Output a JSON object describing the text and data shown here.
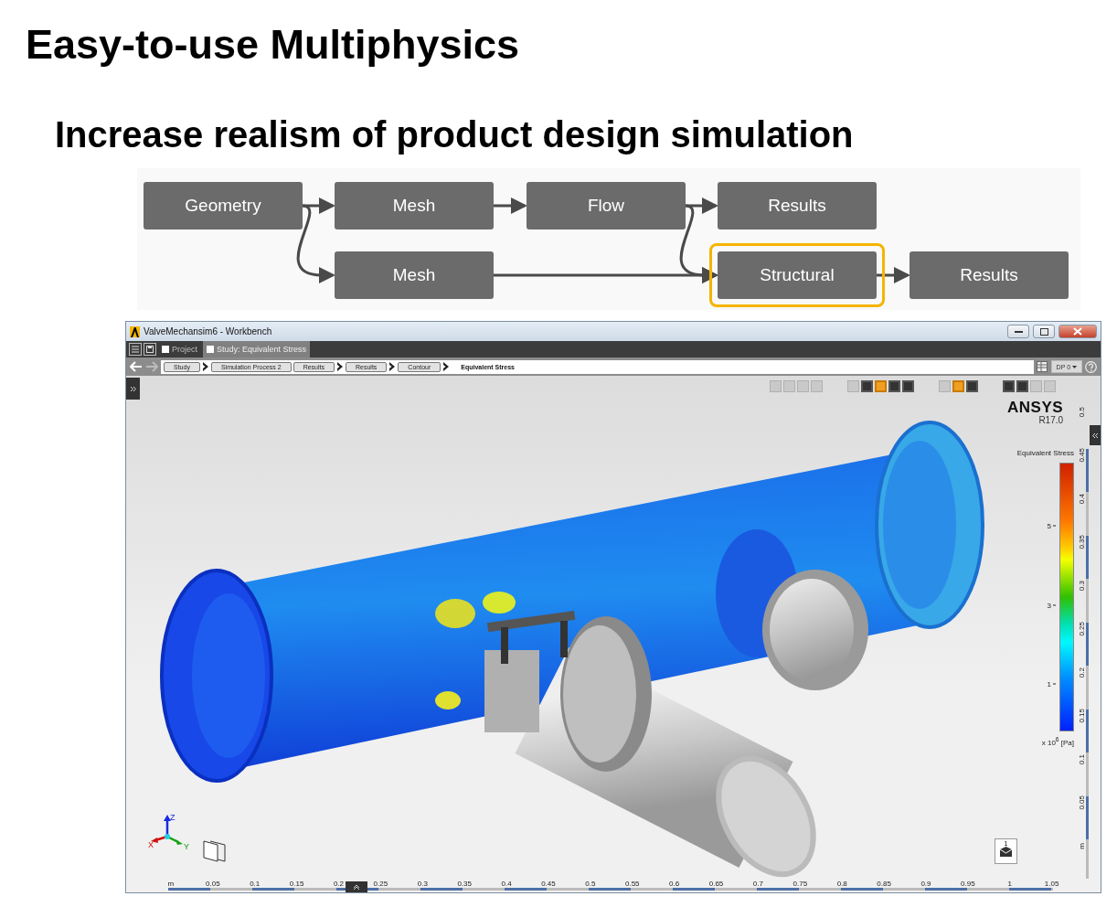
{
  "slide": {
    "title": "Easy-to-use Multiphysics",
    "subtitle": "Increase realism of product design simulation"
  },
  "workflow": {
    "nodes": [
      {
        "label": "Geometry",
        "highlighted": false
      },
      {
        "label": "Mesh",
        "highlighted": false
      },
      {
        "label": "Flow",
        "highlighted": false
      },
      {
        "label": "Results",
        "highlighted": false
      },
      {
        "label": "Mesh",
        "highlighted": false
      },
      {
        "label": "Structural",
        "highlighted": true
      },
      {
        "label": "Results",
        "highlighted": false
      }
    ]
  },
  "window": {
    "title": "ValveMechansim6 - Workbench",
    "tabs": [
      {
        "label": "Project",
        "selected": false
      },
      {
        "label": "Study: Equivalent Stress",
        "selected": true
      }
    ],
    "breadcrumb": [
      {
        "label": "Study",
        "kind": "button",
        "arrow_before": false
      },
      {
        "label": "Simulation Process 2",
        "kind": "button",
        "arrow_before": true
      },
      {
        "label": "Results",
        "kind": "button",
        "arrow_before": false
      },
      {
        "label": "Results",
        "kind": "button",
        "arrow_before": true
      },
      {
        "label": "Contour",
        "kind": "button",
        "arrow_before": true
      },
      {
        "label": "Equivalent Stress",
        "kind": "current",
        "arrow_before": true
      }
    ],
    "design_point": "DP 0",
    "toolbar_groups": [
      [
        {
          "active": false,
          "disabled": true
        },
        {
          "active": false,
          "disabled": true
        },
        {
          "active": false,
          "disabled": true
        },
        {
          "active": false,
          "disabled": true
        }
      ],
      [
        {
          "active": false,
          "disabled": true
        },
        {
          "active": false,
          "disabled": false
        },
        {
          "active": true,
          "disabled": false
        },
        {
          "active": false,
          "disabled": false
        },
        {
          "active": false,
          "disabled": false
        }
      ],
      [
        {
          "active": false,
          "disabled": true
        },
        {
          "active": true,
          "disabled": false
        },
        {
          "active": false,
          "disabled": false
        }
      ],
      [
        {
          "active": false,
          "disabled": false
        },
        {
          "active": false,
          "disabled": false
        },
        {
          "active": false,
          "disabled": true
        },
        {
          "active": false,
          "disabled": true
        }
      ]
    ],
    "logo": {
      "name": "ANSYS",
      "version": "R17.0"
    },
    "legend": {
      "title": "Equivalent Stress",
      "ticks": [
        "5",
        "3",
        "1"
      ],
      "unit": "x 10$^{6}$ [Pa]"
    },
    "axes": [
      "X",
      "Y",
      "Z"
    ],
    "view_count": "1",
    "bottom_ruler": [
      "m",
      "0.05",
      "0.1",
      "0.15",
      "0.2",
      "0.25",
      "0.3",
      "0.35",
      "0.4",
      "0.45",
      "0.5",
      "0.55",
      "0.6",
      "0.65",
      "0.7",
      "0.75",
      "0.8",
      "0.85",
      "0.9",
      "0.95",
      "1",
      "1.05"
    ],
    "side_ruler": [
      "0.5",
      "0.45",
      "0.4",
      "0.35",
      "0.3",
      "0.25",
      "0.2",
      "0.15",
      "0.1",
      "0.05",
      "m"
    ]
  }
}
